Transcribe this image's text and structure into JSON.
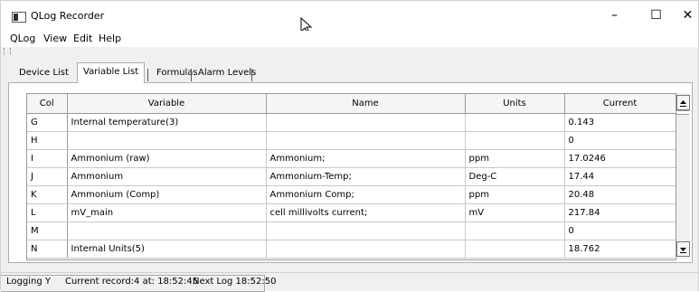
{
  "window": {
    "title": "QLog Recorder",
    "controls": {
      "minimize": "–",
      "maximize": "☐",
      "close": "✕"
    }
  },
  "menu": {
    "items": [
      "QLog",
      "View",
      "Edit",
      "Help"
    ]
  },
  "tabs": [
    {
      "label": "Device List",
      "active": false
    },
    {
      "label": "Variable List",
      "active": true
    },
    {
      "label": "Formulas",
      "active": false
    },
    {
      "label": "Alarm Levels",
      "active": false
    }
  ],
  "table": {
    "columns": [
      "Col",
      "Variable",
      "Name",
      "Units",
      "Current"
    ],
    "rows": [
      [
        "G",
        "Internal temperature(3)",
        "",
        "",
        "0.143"
      ],
      [
        "H",
        "",
        "",
        "",
        "0"
      ],
      [
        "I",
        "Ammonium (raw)",
        "Ammonium;",
        "ppm",
        "17.0246"
      ],
      [
        "J",
        "Ammonium",
        "Ammonium-Temp;",
        "Deg-C",
        "17.44"
      ],
      [
        "K",
        "Ammonium (Comp)",
        "Ammonium Comp;",
        "ppm",
        "20.48"
      ],
      [
        "L",
        "mV_main",
        "cell millivolts current;",
        "mV",
        "217.84"
      ],
      [
        "M",
        "",
        "",
        "",
        "0"
      ],
      [
        "N",
        "Internal Units(5)",
        "",
        "",
        "18.762"
      ]
    ]
  },
  "scrollbar": {
    "up_arrow": "▲",
    "down_arrow": "▼"
  },
  "status": {
    "logging": "Logging Y",
    "current_record": "Current record:4 at: 18:52:45",
    "next_log": "Next Log 18:52:50"
  }
}
